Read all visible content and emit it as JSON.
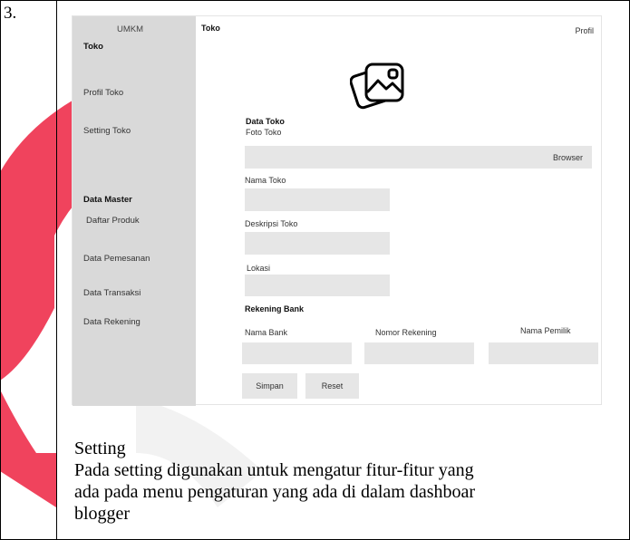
{
  "row_number": "3.",
  "sidebar": {
    "brand": "UMKM",
    "section_toko": "Toko",
    "item_profil_toko": "Profil Toko",
    "item_setting_toko": "Setting Toko",
    "section_data_master": "Data Master",
    "item_daftar_produk": "Daftar Produk",
    "item_data_pemesanan": "Data Pemesanan",
    "item_data_transaksi": "Data Transaksi",
    "item_data_rekening": "Data Rekening"
  },
  "header": {
    "title": "Toko",
    "profile_link": "Profil"
  },
  "form": {
    "section_title": "Data Toko",
    "foto_label": "Foto Toko",
    "browse_label": "Browser",
    "nama_label": "Nama Toko",
    "deskripsi_label": "Deskripsi Toko",
    "lokasi_label": "Lokasi",
    "bank_section_title": "Rekening Bank",
    "nama_bank_label": "Nama Bank",
    "nomor_rekening_label": "Nomor Rekening",
    "nama_pemilik_label": "Nama Pemilik",
    "save_label": "Simpan",
    "reset_label": "Reset"
  },
  "icons": {
    "photo": "image-gallery-icon"
  },
  "caption": {
    "title": "Setting",
    "line1": "Pada setting digunakan untuk mengatur fitur-fitur yang",
    "line2": "ada pada menu pengaturan yang ada di dalam dashboar",
    "line3": "blogger"
  },
  "colors": {
    "sidebar_bg": "#d9d9d9",
    "field_bg": "#e6e6e6",
    "watermark": "#ee2f4b"
  }
}
